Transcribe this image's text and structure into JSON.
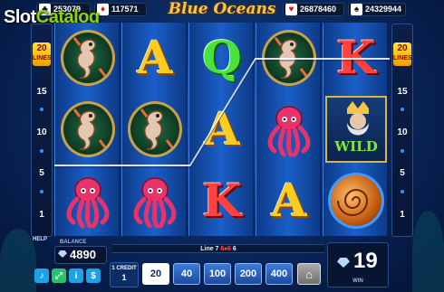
{
  "brand": {
    "part1": "Slot",
    "part2": "Catalog"
  },
  "title": "Blue Oceans",
  "jackpots": [
    {
      "suit": "♣",
      "suit_color": "black",
      "value": "253079"
    },
    {
      "suit": "♦",
      "suit_color": "red",
      "value": "117571"
    },
    {
      "suit": "♥",
      "suit_color": "red",
      "value": "26878460"
    },
    {
      "suit": "♠",
      "suit_color": "black",
      "value": "24329944"
    }
  ],
  "lines_badge": {
    "count": "20",
    "label": "LINES"
  },
  "line_numbers": [
    "15",
    "10",
    "5",
    "1"
  ],
  "help_label": "HELP",
  "reels": [
    [
      "seahorse",
      "seahorse",
      "octopus"
    ],
    [
      "A",
      "seahorse",
      "octopus"
    ],
    [
      "Q",
      "A",
      "K"
    ],
    [
      "seahorse",
      "octopus",
      "A"
    ],
    [
      "K",
      "wild",
      "shell"
    ]
  ],
  "wild_label": "WILD",
  "balance": {
    "label": "BALANCE",
    "value": "4890"
  },
  "info": {
    "prefix": "Line 7",
    "symbol": "6♠6",
    "suffix": "6"
  },
  "credit": {
    "label": "1 CREDIT",
    "value": "1"
  },
  "bets": [
    "20",
    "40",
    "100",
    "200",
    "400"
  ],
  "selected_bet": "20",
  "win": {
    "value": "19",
    "label": "WIN"
  },
  "controls": {
    "ctrl1": "♪",
    "ctrl2": "⤢",
    "ctrl3": "i",
    "ctrl4": "$",
    "home": "⌂"
  },
  "colors": {
    "accent": "#f3c64a",
    "panel": "#071530",
    "bet_button": "#2a66c4"
  }
}
